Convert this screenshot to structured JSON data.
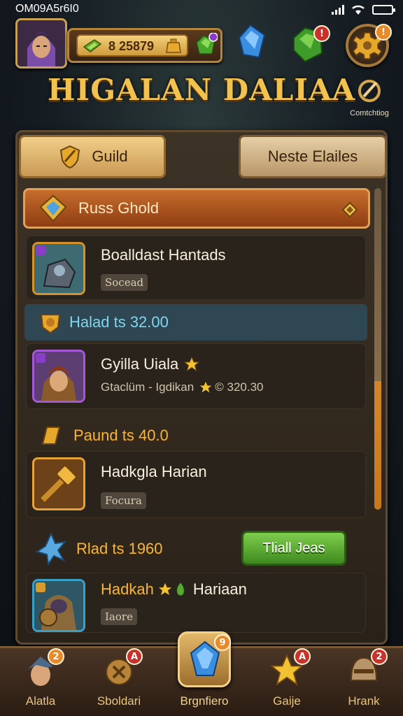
{
  "status_bar": {
    "time": "OM09A5r6I0"
  },
  "hud": {
    "coins": "8 25879",
    "settings_badge": "!",
    "gem_badge": "!",
    "connect_label": "Comtchtiog"
  },
  "title": "HIGALAN DALIAA",
  "tabs": {
    "guild": "Guild",
    "other": "Neste Elailes"
  },
  "guild_header": "Russ Ghold",
  "rows": [
    {
      "title": "Boalldast Hantads",
      "tag": "Socead"
    },
    {
      "title": "Gyilla Uiala",
      "subtitle": "Gtaclüm - Igdikan",
      "subtitle_value": "© 320.30"
    },
    {
      "title": "Hadkgla Harian",
      "tag": "Focura"
    },
    {
      "title": "Hadkah",
      "title2": "Hariaan",
      "tag": "Iaore"
    }
  ],
  "sections": [
    {
      "label": "Halad ts 32.00"
    },
    {
      "label": "Paund ts 40.0"
    },
    {
      "label": "Rlad ts 1960"
    }
  ],
  "trial_button": "Tliall Jeas",
  "nav": [
    {
      "label": "Alatla",
      "badge": "2"
    },
    {
      "label": "Sboldari",
      "badge": "A"
    },
    {
      "label": "Brgnfiero",
      "badge": "9"
    },
    {
      "label": "Gaije",
      "badge": "A"
    },
    {
      "label": "Hrank",
      "badge": "2"
    }
  ],
  "colors": {
    "accent_gold": "#f2b43a",
    "header_orange": "#c66d2c",
    "trial_green": "#5aa833",
    "badge_red": "#c8322a",
    "badge_orange": "#e8892a"
  }
}
